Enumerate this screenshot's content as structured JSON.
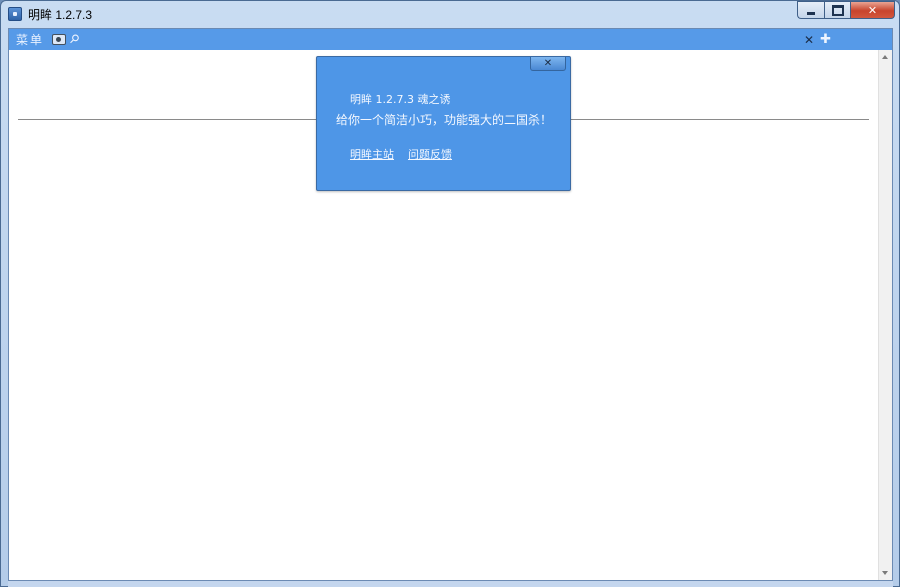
{
  "window": {
    "title": "明眸 1.2.7.3",
    "controls": {
      "minimize_icon": "minimize-icon",
      "maximize_icon": "maximize-icon",
      "close_label": "✕"
    }
  },
  "toolbar": {
    "menu_label": "菜单",
    "icons": [
      "camera-icon",
      "pin-icon"
    ],
    "right": {
      "close_tab_label": "✕",
      "add_tab_label": "✚"
    }
  },
  "popup": {
    "close_label": "✕",
    "line1": "明眸 1.2.7.3 魂之诱",
    "line2": "给你一个简洁小巧，功能强大的二国杀！",
    "links": [
      "明眸主站",
      "问题反馈"
    ]
  },
  "colors": {
    "accent": "#569ae8",
    "popup_bg": "#4e96e7",
    "title_bar": "#c9dcf2",
    "close_button": "#c8442c"
  }
}
